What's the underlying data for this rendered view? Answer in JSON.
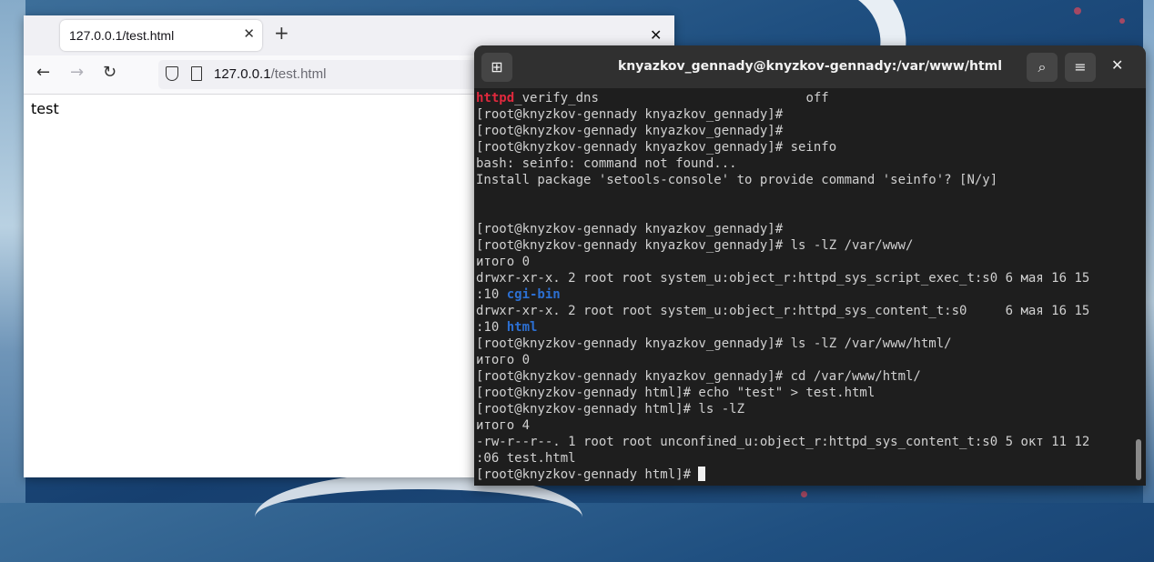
{
  "browser": {
    "tab_title": "127.0.0.1/test.html",
    "url_host": "127.0.0.1",
    "url_path": "/test.html",
    "page_text": "test"
  },
  "terminal": {
    "title": "knyazkov_gennady@knyzkov-gennady:/var/www/html",
    "lines": [
      {
        "segments": [
          {
            "text": "httpd",
            "color": "red"
          },
          {
            "text": "_verify_dns                           off"
          }
        ]
      },
      {
        "segments": [
          {
            "text": "[root@knyzkov-gennady knyazkov_gennady]#"
          }
        ]
      },
      {
        "segments": [
          {
            "text": "[root@knyzkov-gennady knyazkov_gennady]#"
          }
        ]
      },
      {
        "segments": [
          {
            "text": "[root@knyzkov-gennady knyazkov_gennady]# seinfo"
          }
        ]
      },
      {
        "segments": [
          {
            "text": "bash: seinfo: command not found..."
          }
        ]
      },
      {
        "segments": [
          {
            "text": "Install package 'setools-console' to provide command 'seinfo'? [N/y]"
          }
        ]
      },
      {
        "segments": [
          {
            "text": ""
          }
        ]
      },
      {
        "segments": [
          {
            "text": ""
          }
        ]
      },
      {
        "segments": [
          {
            "text": "[root@knyzkov-gennady knyazkov_gennady]#"
          }
        ]
      },
      {
        "segments": [
          {
            "text": "[root@knyzkov-gennady knyazkov_gennady]# ls -lZ /var/www/"
          }
        ]
      },
      {
        "segments": [
          {
            "text": "итого 0"
          }
        ]
      },
      {
        "segments": [
          {
            "text": "drwxr-xr-x. 2 root root system_u:object_r:httpd_sys_script_exec_t:s0 6 мая 16 15"
          }
        ]
      },
      {
        "segments": [
          {
            "text": ":10 "
          },
          {
            "text": "cgi-bin",
            "color": "blue"
          }
        ]
      },
      {
        "segments": [
          {
            "text": "drwxr-xr-x. 2 root root system_u:object_r:httpd_sys_content_t:s0     6 мая 16 15"
          }
        ]
      },
      {
        "segments": [
          {
            "text": ":10 "
          },
          {
            "text": "html",
            "color": "blue"
          }
        ]
      },
      {
        "segments": [
          {
            "text": "[root@knyzkov-gennady knyazkov_gennady]# ls -lZ /var/www/html/"
          }
        ]
      },
      {
        "segments": [
          {
            "text": "итого 0"
          }
        ]
      },
      {
        "segments": [
          {
            "text": "[root@knyzkov-gennady knyazkov_gennady]# cd /var/www/html/"
          }
        ]
      },
      {
        "segments": [
          {
            "text": "[root@knyzkov-gennady html]# echo \"test\" > test.html"
          }
        ]
      },
      {
        "segments": [
          {
            "text": "[root@knyzkov-gennady html]# ls -lZ"
          }
        ]
      },
      {
        "segments": [
          {
            "text": "итого 4"
          }
        ]
      },
      {
        "segments": [
          {
            "text": "-rw-r--r--. 1 root root unconfined_u:object_r:httpd_sys_content_t:s0 5 окт 11 12"
          }
        ]
      },
      {
        "segments": [
          {
            "text": ":06 test.html"
          }
        ]
      },
      {
        "segments": [
          {
            "text": "[root@knyzkov-gennady html]# "
          }
        ],
        "cursor": true
      }
    ]
  },
  "icons": {
    "new_tab": "plus-icon",
    "back": "arrow-left-icon",
    "forward": "arrow-right-icon",
    "reload": "reload-icon",
    "search": "search-icon",
    "menu": "hamburger-icon",
    "close": "close-icon"
  }
}
